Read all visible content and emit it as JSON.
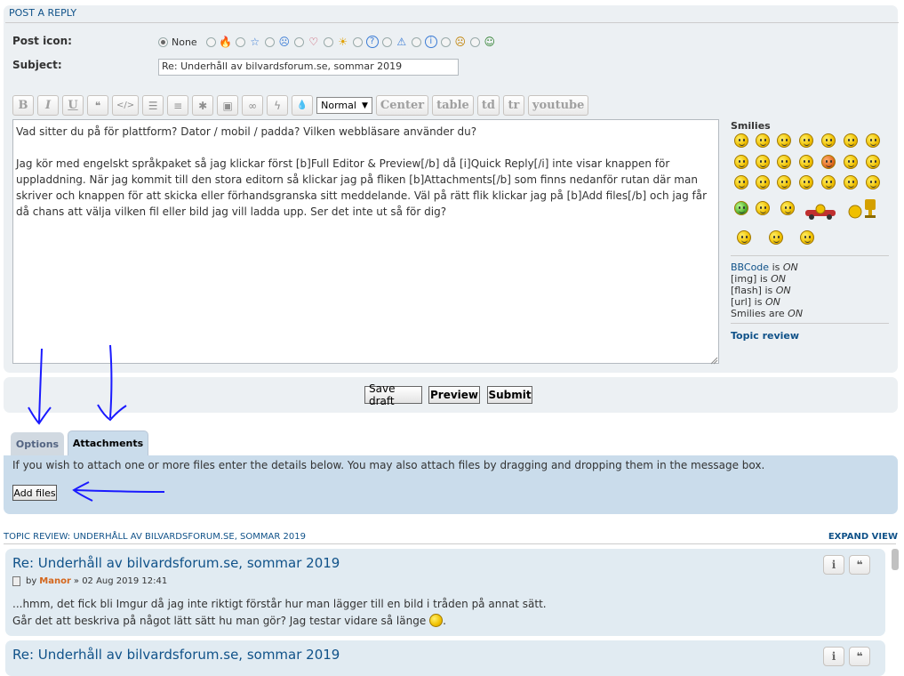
{
  "post_form": {
    "header": "POST A REPLY",
    "post_icon_label": "Post icon:",
    "none_label": "None",
    "post_icons": [
      "fire-icon",
      "star-icon",
      "shocked-face-icon",
      "heart-icon",
      "sun-icon",
      "question-icon",
      "warning-icon",
      "info-icon",
      "sad-face-icon",
      "grin-face-icon"
    ],
    "subject_label": "Subject:",
    "subject_value": "Re: Underhåll av bilvardsforum.se, sommar 2019"
  },
  "toolbar": {
    "bold": "B",
    "italic": "I",
    "underline": "U",
    "quote": "❝",
    "code": "</>",
    "list": "☰",
    "numbered_list": "≡",
    "list_item": "✱",
    "image": "▣",
    "link": "∞",
    "flash": "ϟ",
    "color": "💧",
    "font_size": "Normal",
    "center": "Center",
    "table": "table",
    "td": "td",
    "tr": "tr",
    "youtube": "youtube"
  },
  "message": "Vad sitter du på för plattform? Dator / mobil / padda? Vilken webbläsare använder du?\n\nJag kör med engelskt språkpaket så jag klickar först [b]Full Editor & Preview[/b] då [i]Quick Reply[/i] inte visar knappen för uppladdning. När jag kommit till den stora editorn så klickar jag på fliken [b]Attachments[/b] som finns nedanför rutan där man skriver och knappen för att skicka eller förhandsgranska sitt meddelande. Väl på rätt flik klickar jag på [b]Add files[/b] och jag får då chans att välja vilken fil eller bild jag vill ladda upp. Ser det inte ut så för dig?",
  "sidebar": {
    "smilies_title": "Smilies",
    "bbcode_label": "BBCode",
    "bbcode_state": "ON",
    "img_label": "[img]",
    "img_state": "ON",
    "flash_label": "[flash]",
    "flash_state": "ON",
    "url_label": "[url]",
    "url_state": "ON",
    "smilies_label": "Smilies are",
    "smilies_state": "ON",
    "is_word": "is",
    "topic_review": "Topic review"
  },
  "buttons": {
    "save_draft": "Save draft",
    "preview": "Preview",
    "submit": "Submit"
  },
  "tabs": {
    "options": "Options",
    "attachments": "Attachments"
  },
  "attachments": {
    "help_text": "If you wish to attach one or more files enter the details below. You may also attach files by dragging and dropping them in the message box.",
    "add_files": "Add files"
  },
  "topic_review": {
    "header": "TOPIC REVIEW: UNDERHÅLL AV BILVARDSFORUM.SE, SOMMAR 2019",
    "expand": "EXPAND VIEW",
    "posts": [
      {
        "title": "Re: Underhåll av bilvardsforum.se, sommar 2019",
        "by": "by",
        "author": "Manor",
        "date": "» 02 Aug 2019 12:41",
        "line1": "...hmm, det fick bli Imgur då jag inte riktigt förstår hur man lägger till en bild i tråden på annat sätt.",
        "line2": "Går det att beskriva på något lätt sätt hu man gör? Jag testar vidare så länge"
      },
      {
        "title": "Re: Underhåll av bilvardsforum.se, sommar 2019"
      }
    ],
    "info_button": "i",
    "quote_button": "❝"
  },
  "colors": {
    "panel_bg": "#ecf0f3",
    "tab_panel_bg": "#cadceb",
    "link_blue": "#105289",
    "author_orange": "#d4661c",
    "annotation_blue": "#1a1aff"
  }
}
